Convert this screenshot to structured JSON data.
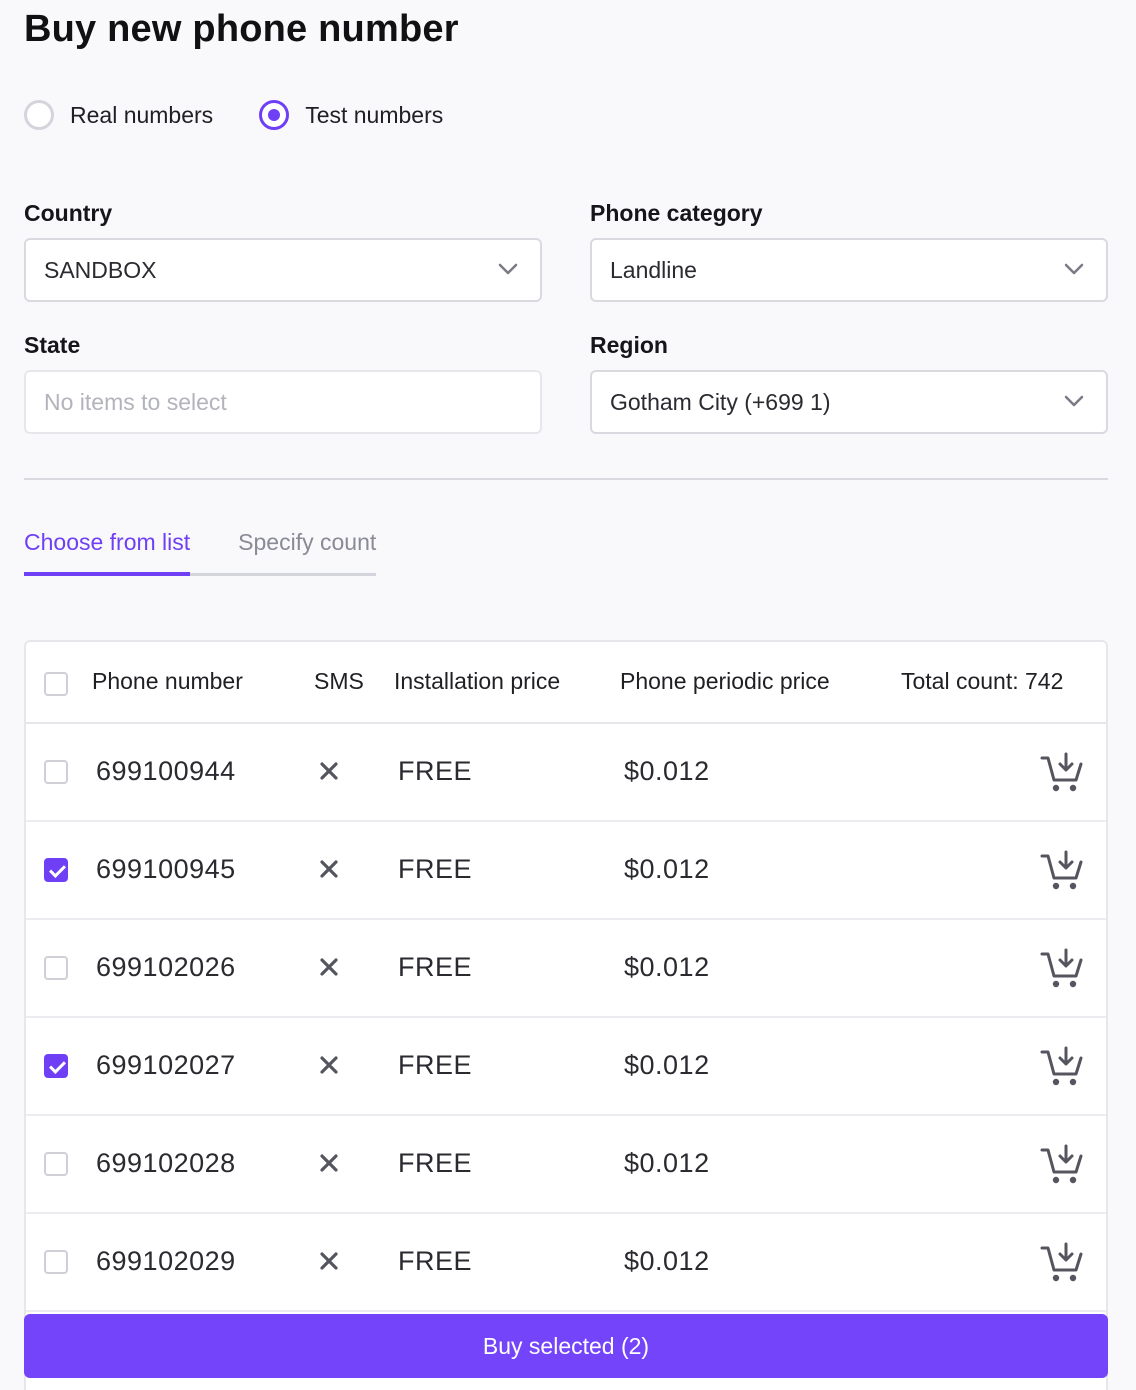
{
  "page": {
    "title": "Buy new phone number"
  },
  "number_type": {
    "options": [
      {
        "label": "Real numbers",
        "checked": false
      },
      {
        "label": "Test numbers",
        "checked": true
      }
    ]
  },
  "filters": {
    "country": {
      "label": "Country",
      "value": "SANDBOX"
    },
    "phone_category": {
      "label": "Phone category",
      "value": "Landline"
    },
    "state": {
      "label": "State",
      "placeholder": "No items to select"
    },
    "region": {
      "label": "Region",
      "value": "Gotham City (+699 1)"
    }
  },
  "tabs": [
    {
      "label": "Choose from list",
      "active": true
    },
    {
      "label": "Specify count",
      "active": false
    }
  ],
  "table": {
    "headers": {
      "phone_number": "Phone number",
      "sms": "SMS",
      "installation_price": "Installation price",
      "periodic_price": "Phone periodic price",
      "total_count": "Total count: 742"
    },
    "rows": [
      {
        "phone": "699100944",
        "installation": "FREE",
        "periodic": "$0.012",
        "selected": false
      },
      {
        "phone": "699100945",
        "installation": "FREE",
        "periodic": "$0.012",
        "selected": true
      },
      {
        "phone": "699102026",
        "installation": "FREE",
        "periodic": "$0.012",
        "selected": false
      },
      {
        "phone": "699102027",
        "installation": "FREE",
        "periodic": "$0.012",
        "selected": true
      },
      {
        "phone": "699102028",
        "installation": "FREE",
        "periodic": "$0.012",
        "selected": false
      },
      {
        "phone": "699102029",
        "installation": "FREE",
        "periodic": "$0.012",
        "selected": false
      }
    ]
  },
  "actions": {
    "buy_selected": "Buy selected (2)"
  },
  "colors": {
    "accent": "#6e3ff5",
    "button": "#7444fb"
  }
}
